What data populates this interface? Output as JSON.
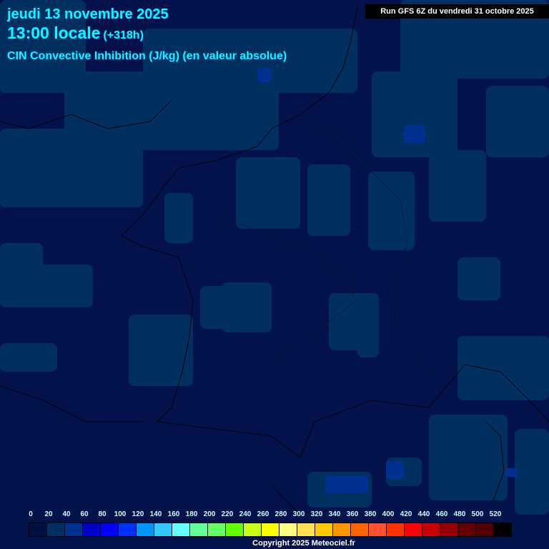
{
  "header": {
    "date": "jeudi 13 novembre 2025",
    "time": "13:00 locale",
    "offset": "(+318h)",
    "parameter": "CIN Convective Inhibition (J/kg) (en valeur absolue)",
    "run": "Run GFS 6Z du vendredi 31 octobre 2025"
  },
  "legend": {
    "labels": [
      "0",
      "20",
      "40",
      "60",
      "80",
      "100",
      "120",
      "140",
      "160",
      "180",
      "200",
      "220",
      "240",
      "260",
      "280",
      "300",
      "320",
      "340",
      "360",
      "380",
      "400",
      "420",
      "440",
      "460",
      "480",
      "500",
      "520"
    ],
    "colors": [
      "#001040",
      "#003060",
      "#003090",
      "#0000c8",
      "#0000ff",
      "#0030ff",
      "#0096ff",
      "#32c8ff",
      "#64ffff",
      "#64ff96",
      "#64ff64",
      "#64ff00",
      "#c8ff14",
      "#ffff00",
      "#ffff80",
      "#ffe050",
      "#ffc800",
      "#ff9600",
      "#ff6400",
      "#ff5032",
      "#ff3200",
      "#ff0000",
      "#c80000",
      "#960000",
      "#640000",
      "#500000",
      "#000000"
    ]
  },
  "copyright": "Copyright 2025 Meteociel.fr"
}
